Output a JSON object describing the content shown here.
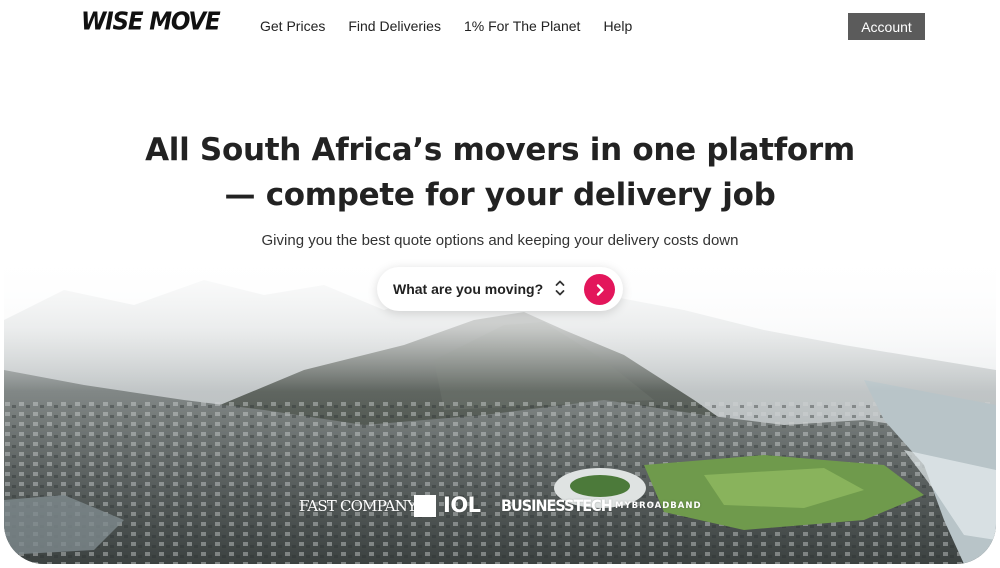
{
  "header": {
    "logo": "WISE MOVE",
    "nav": [
      "Get Prices",
      "Find Deliveries",
      "1% For The Planet",
      "Help"
    ],
    "account_label": "Account"
  },
  "hero": {
    "title_line1": "All South Africa’s movers in one platform",
    "title_line2": "— compete for your delivery job",
    "subtitle": "Giving you the best quote options and keeping your delivery costs down"
  },
  "search": {
    "label": "What are you moving?",
    "selector_icon": "up-down-chevron-icon",
    "go_icon": "chevron-right-icon"
  },
  "press": {
    "logos": [
      "FAST COMPANY",
      "IOL",
      "BUSINESSTECH",
      "MYBROADBAND"
    ]
  },
  "colors": {
    "accent": "#e3165b",
    "account_bg": "#5b5b5b",
    "text": "#222222"
  }
}
